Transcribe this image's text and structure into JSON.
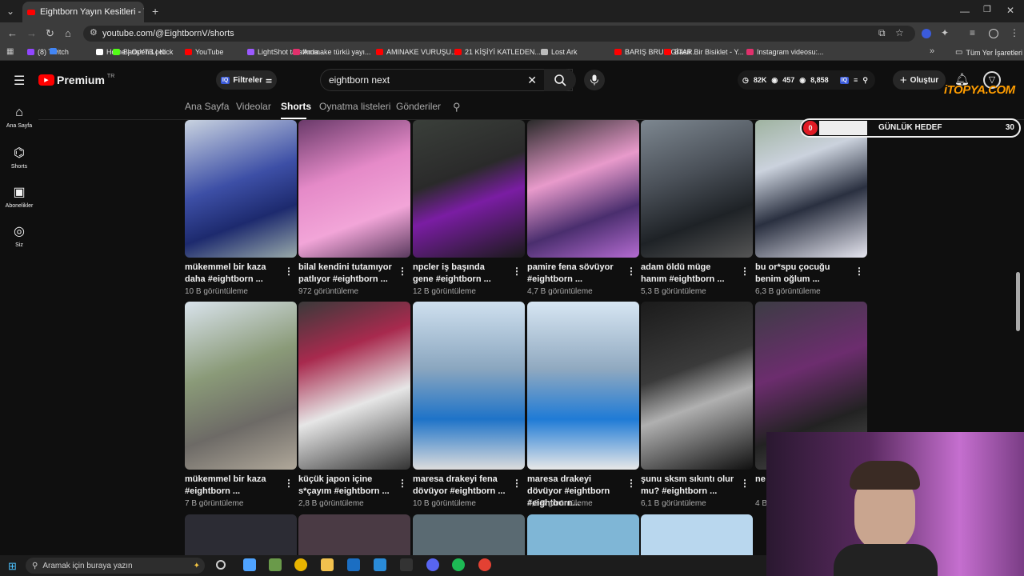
{
  "browser": {
    "tab_title": "Eightborn Yayın Kesitleri - YouT",
    "url": "youtube.com/@EightbornV/shorts",
    "bookmarks": [
      {
        "label": "(8) Twitch",
        "color": "#9146ff"
      },
      {
        "label": "",
        "color": "#4285f4"
      },
      {
        "label": "Home | Open Loot",
        "color": "#ffffff"
      },
      {
        "label": "BarisYTB | Kick",
        "color": "#53fc18"
      },
      {
        "label": "YouTube",
        "color": "#ff0000"
      },
      {
        "label": "LightShot tarafında...",
        "color": "#9b59ff"
      },
      {
        "label": "Amınake türkü yayı...",
        "color": "#e1306c"
      },
      {
        "label": "AMINAKE VURUŞU...",
        "color": "#ff0000"
      },
      {
        "label": "21 KİŞİYİ KATLEDEN...",
        "color": "#ff0000"
      },
      {
        "label": "Lost Ark",
        "color": "#bbbbbb"
      },
      {
        "label": "BARIŞ BRUH GİTAR...",
        "color": "#ff0000"
      },
      {
        "label": "Basik Bir Bisiklet - Y...",
        "color": "#ff0000"
      },
      {
        "label": "Instagram videosu:...",
        "color": "#e1306c"
      }
    ],
    "all_bookmarks": "Tüm Yer İşaretleri"
  },
  "youtube": {
    "logo": "Premium",
    "logo_sup": "TR",
    "filters_label": "Filtreler",
    "search_value": "eightborn next",
    "stats": {
      "a": "82K",
      "b": "457",
      "c": "8,858"
    },
    "create_label": "Oluştur"
  },
  "sidebar": [
    {
      "label": "Ana Sayfa"
    },
    {
      "label": "Shorts"
    },
    {
      "label": "Abonelikler"
    },
    {
      "label": "Siz"
    }
  ],
  "channel_tabs": [
    "Ana Sayfa",
    "Videolar",
    "Shorts",
    "Oynatma listeleri",
    "Gönderiler"
  ],
  "shorts": [
    {
      "title": "mükemmel bir kaza daha  #eightborn ...",
      "views": "10 B görüntüleme"
    },
    {
      "title": "bilal kendini tutamıyor patlıyor  #eightborn ...",
      "views": "972 görüntüleme"
    },
    {
      "title": "npcler iş başında gene #eightborn ...",
      "views": "12 B görüntüleme"
    },
    {
      "title": "pamire fena sövüyor #eightborn ...",
      "views": "4,7 B görüntüleme"
    },
    {
      "title": "adam öldü müge hanım #eightborn ...",
      "views": "5,3 B görüntüleme"
    },
    {
      "title": "bu or*spu çocuğu benim oğlum  ...",
      "views": "6,3 B görüntüleme"
    },
    {
      "title": "mükemmel bir kaza #eightborn ...",
      "views": "7 B görüntüleme"
    },
    {
      "title": "küçük japon içine s*çayım  #eightborn ...",
      "views": "2,8 B görüntüleme"
    },
    {
      "title": "maresa drakeyi fena dövüyor  #eightborn ...",
      "views": "10 B görüntüleme"
    },
    {
      "title": "maresa drakeyi dövüyor #eightborn #eightborn...",
      "views": "4,8 B görüntüleme"
    },
    {
      "title": "şunu sksm sıkıntı olur mu?  #eightborn ...",
      "views": "6,1 B görüntüleme"
    },
    {
      "title": "ne",
      "views": "4 B"
    }
  ],
  "overlay": {
    "goal_count": "0",
    "goal_label": "GÜNLÜK HEDEF",
    "goal_target": "30",
    "brand": "iTOPYA.COM"
  },
  "taskbar": {
    "search_placeholder": "Aramak için buraya yazın"
  }
}
